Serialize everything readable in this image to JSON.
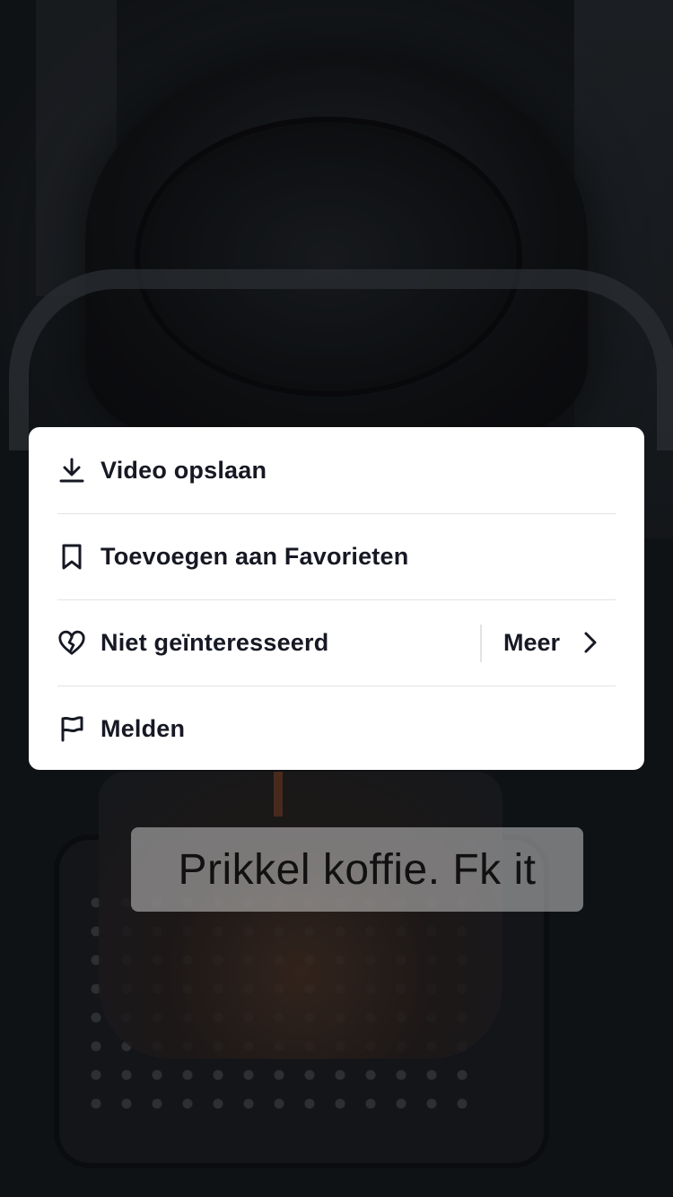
{
  "menu": {
    "items": [
      {
        "label": "Video opslaan",
        "icon": "download-icon"
      },
      {
        "label": "Toevoegen aan Favorieten",
        "icon": "bookmark-icon"
      },
      {
        "label": "Niet geïnteresseerd",
        "icon": "broken-heart-icon",
        "more_label": "Meer"
      },
      {
        "label": "Melden",
        "icon": "flag-icon"
      }
    ]
  },
  "video": {
    "caption": "Prikkel koffie. Fk it"
  },
  "colors": {
    "sheet_background": "#ffffff",
    "text_primary": "#161823",
    "divider": "#e3e3e4"
  }
}
